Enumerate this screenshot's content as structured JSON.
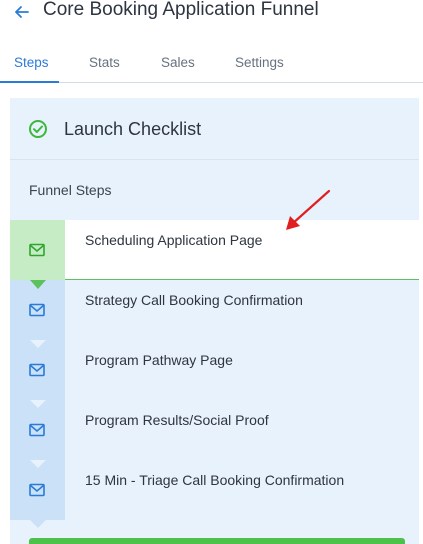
{
  "header": {
    "title": "Core Booking Application Funnel"
  },
  "tabs": [
    {
      "label": "Steps"
    },
    {
      "label": "Stats"
    },
    {
      "label": "Sales"
    },
    {
      "label": "Settings"
    }
  ],
  "checklist": {
    "title": "Launch Checklist"
  },
  "funnel": {
    "label": "Funnel Steps",
    "steps": [
      {
        "label": "Scheduling Application Page"
      },
      {
        "label": "Strategy Call Booking Confirmation"
      },
      {
        "label": "Program Pathway Page"
      },
      {
        "label": "Program Results/Social Proof"
      },
      {
        "label": "15 Min - Triage Call Booking Confirmation"
      }
    ]
  },
  "colors": {
    "accent": "#2b7bd6",
    "success": "#4cc24c",
    "annotation": "#e02020"
  }
}
